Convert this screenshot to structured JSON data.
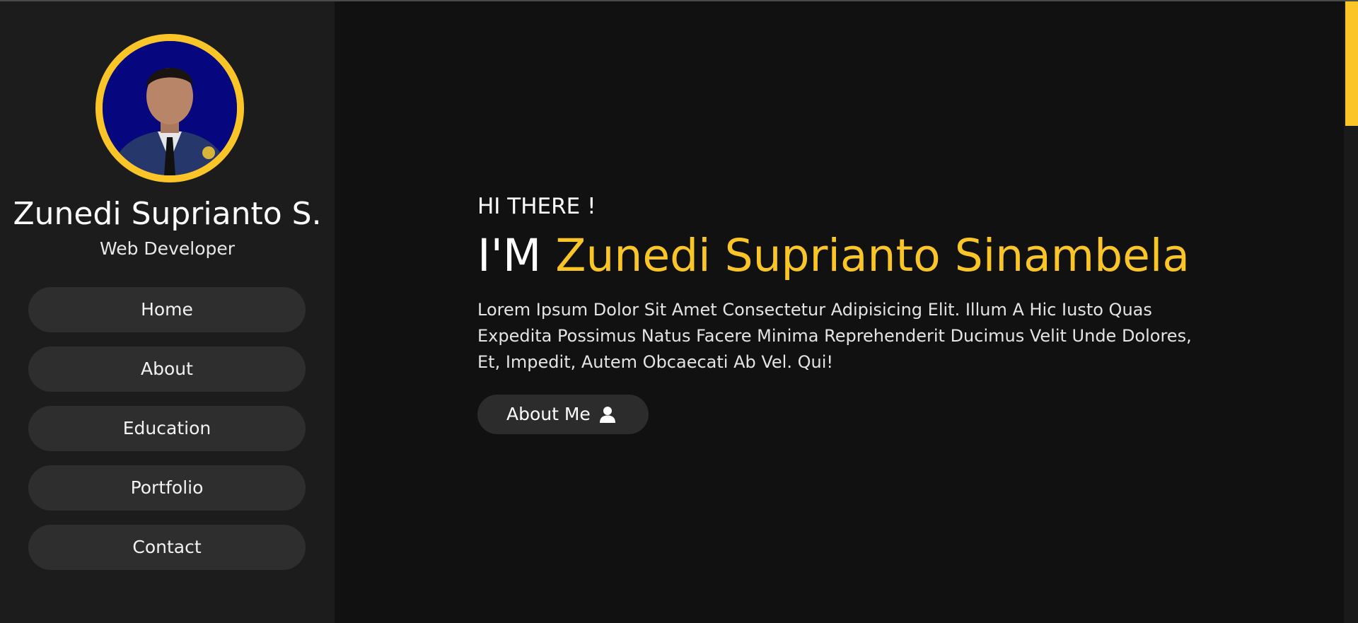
{
  "profile": {
    "name": "Zunedi Suprianto S.",
    "role": "Web Developer"
  },
  "nav": {
    "items": [
      {
        "label": "Home"
      },
      {
        "label": "About"
      },
      {
        "label": "Education"
      },
      {
        "label": "Portfolio"
      },
      {
        "label": "Contact"
      }
    ]
  },
  "hero": {
    "greeting": "HI THERE !",
    "prefix": "I'M",
    "name": "Zunedi Suprianto Sinambela",
    "description": "Lorem Ipsum Dolor Sit Amet Consectetur Adipisicing Elit. Illum A Hic Iusto Quas Expedita Possimus Natus Facere Minima Reprehenderit Ducimus Velit Unde Dolores, Et, Impedit, Autem Obcaecati Ab Vel. Qui!",
    "button_label": "About Me",
    "button_icon": "user-icon"
  },
  "colors": {
    "accent": "#fbc527",
    "sidebar_bg": "#1c1c1c",
    "main_bg": "#111111",
    "nav_item_bg": "#2e2e2e"
  }
}
